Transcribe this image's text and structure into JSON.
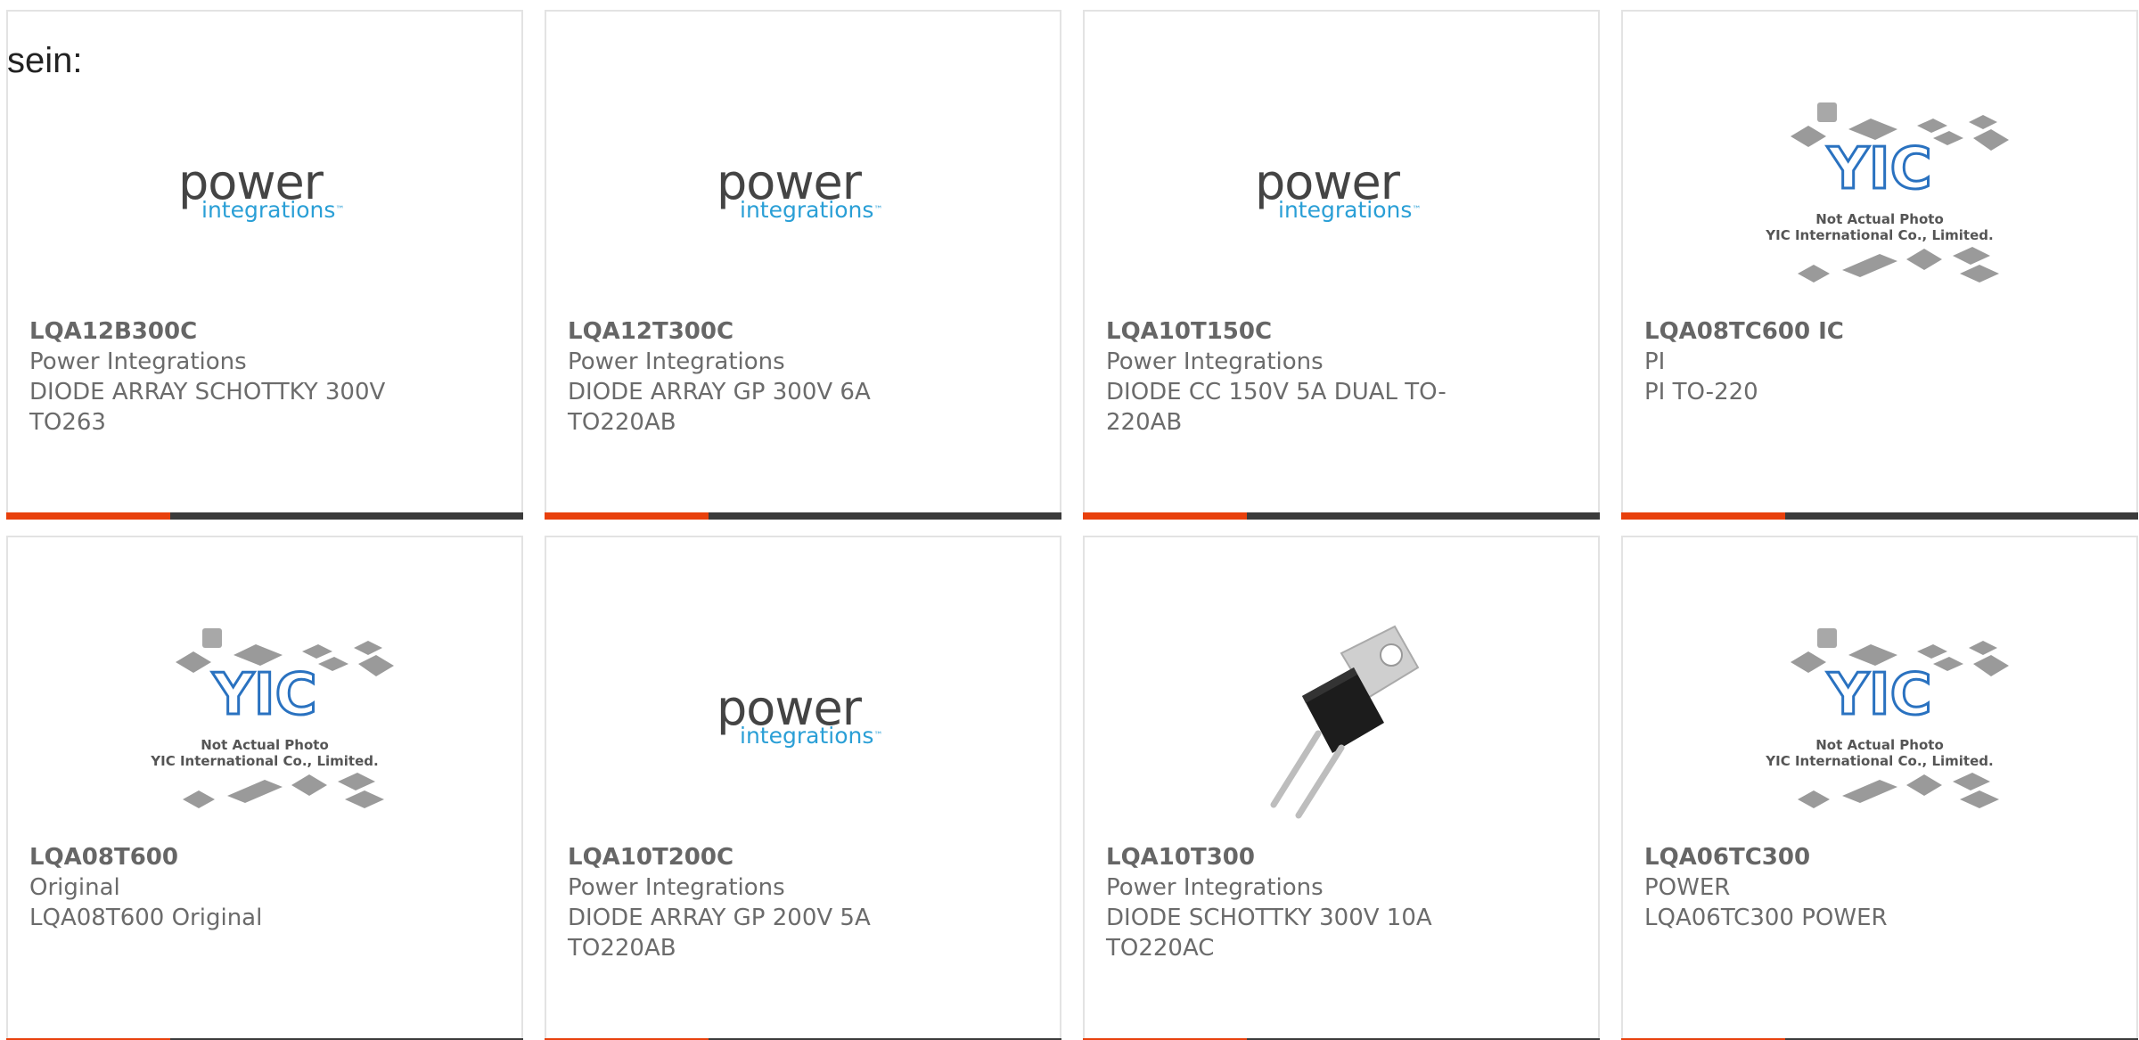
{
  "intro_text": "sein:",
  "colors": {
    "accent": "#e8400c",
    "bar": "#3b3b3b",
    "logo_blue": "#2a9fd6"
  },
  "logo": {
    "power": "power",
    "integrations": "integrations",
    "tm": "™"
  },
  "placeholder": {
    "brand": "YIC",
    "line1": "Not Actual Photo",
    "line2": "YIC International Co., Limited."
  },
  "products": [
    {
      "part": "LQA12B300C",
      "manufacturer": "Power Integrations",
      "description": "DIODE ARRAY SCHOTTKY 300V TO263",
      "image": "power-integrations-logo"
    },
    {
      "part": "LQA12T300C",
      "manufacturer": "Power Integrations",
      "description": "DIODE ARRAY GP 300V 6A TO220AB",
      "image": "power-integrations-logo"
    },
    {
      "part": "LQA10T150C",
      "manufacturer": "Power Integrations",
      "description": "DIODE CC 150V 5A DUAL TO-220AB",
      "image": "power-integrations-logo"
    },
    {
      "part": "LQA08TC600 IC",
      "manufacturer": "PI",
      "description": "PI TO-220",
      "image": "yic-placeholder"
    },
    {
      "part": "LQA08T600",
      "manufacturer": "Original",
      "description": "LQA08T600 Original",
      "image": "yic-placeholder"
    },
    {
      "part": "LQA10T200C",
      "manufacturer": "Power Integrations",
      "description": "DIODE ARRAY GP 200V 5A TO220AB",
      "image": "power-integrations-logo"
    },
    {
      "part": "LQA10T300",
      "manufacturer": "Power Integrations",
      "description": "DIODE SCHOTTKY 300V 10A TO220AC",
      "image": "to220-transistor-photo"
    },
    {
      "part": "LQA06TC300",
      "manufacturer": "POWER",
      "description": "LQA06TC300 POWER",
      "image": "yic-placeholder"
    }
  ]
}
